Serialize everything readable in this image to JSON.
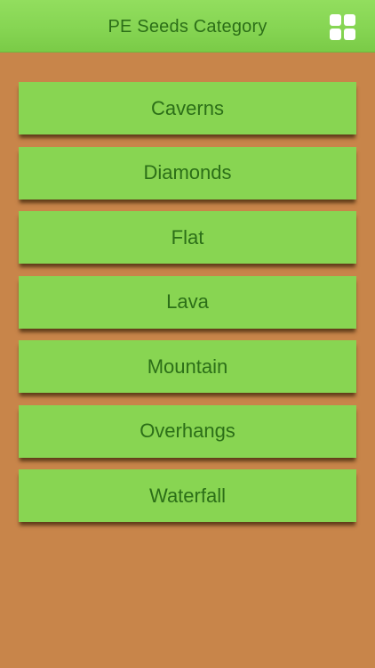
{
  "header": {
    "title": "PE Seeds Category",
    "menu_icon": "grid-icon"
  },
  "categories": [
    {
      "label": "Caverns"
    },
    {
      "label": "Diamonds"
    },
    {
      "label": "Flat"
    },
    {
      "label": "Lava"
    },
    {
      "label": "Mountain"
    },
    {
      "label": "Overhangs"
    },
    {
      "label": "Waterfall"
    }
  ],
  "colors": {
    "background": "#c8854a",
    "nav_bar": "#86d553",
    "button": "#88d552",
    "text": "#2c6f18"
  }
}
